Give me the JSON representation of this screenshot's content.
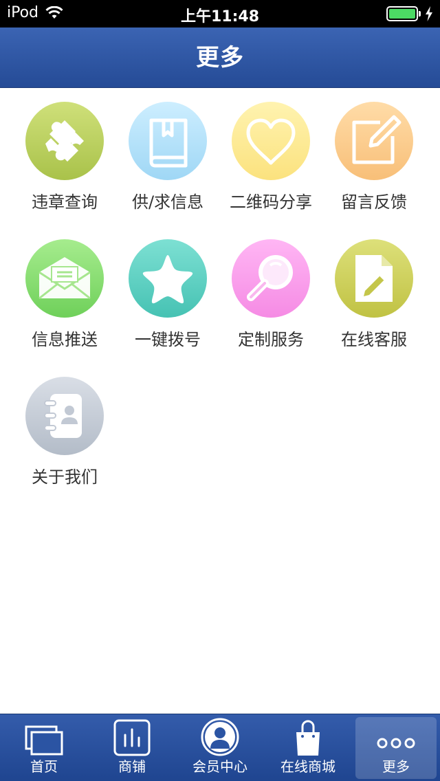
{
  "status_bar": {
    "carrier": "iPod",
    "time": "上午11:48"
  },
  "nav": {
    "title": "更多"
  },
  "colors": {
    "nav_top": "#3b64b3",
    "nav_bottom": "#254b96",
    "battery": "#4cd964"
  },
  "grid_items": [
    {
      "label": "违章查询",
      "icon": "puzzle-icon",
      "color_top": "#cfe07a",
      "color_bottom": "#a9c24a"
    },
    {
      "label": "供/求信息",
      "icon": "book-icon",
      "color_top": "#cdeeff",
      "color_bottom": "#9fd7f5"
    },
    {
      "label": "二维码分享",
      "icon": "heart-icon",
      "color_top": "#fff3b0",
      "color_bottom": "#fbe27e"
    },
    {
      "label": "留言反馈",
      "icon": "edit-icon",
      "color_top": "#ffdca8",
      "color_bottom": "#f8bf78"
    },
    {
      "label": "信息推送",
      "icon": "envelope-icon",
      "color_top": "#a6ec8e",
      "color_bottom": "#6fd05a"
    },
    {
      "label": "一键拨号",
      "icon": "star-icon",
      "color_top": "#7de0d3",
      "color_bottom": "#46c2b3"
    },
    {
      "label": "定制服务",
      "icon": "magnifier-icon",
      "color_top": "#ffb6f4",
      "color_bottom": "#f58be4"
    },
    {
      "label": "在线客服",
      "icon": "document-pencil-icon",
      "color_top": "#dde07a",
      "color_bottom": "#c0c243"
    },
    {
      "label": "关于我们",
      "icon": "contacts-icon",
      "color_top": "#d9dee6",
      "color_bottom": "#b3bcc8"
    }
  ],
  "tabs": [
    {
      "label": "首页",
      "icon": "home-windows-icon"
    },
    {
      "label": "商铺",
      "icon": "shop-chart-icon"
    },
    {
      "label": "会员中心",
      "icon": "member-avatar-icon"
    },
    {
      "label": "在线商城",
      "icon": "shopping-bag-icon"
    },
    {
      "label": "更多",
      "icon": "more-dots-icon",
      "active": true
    }
  ]
}
